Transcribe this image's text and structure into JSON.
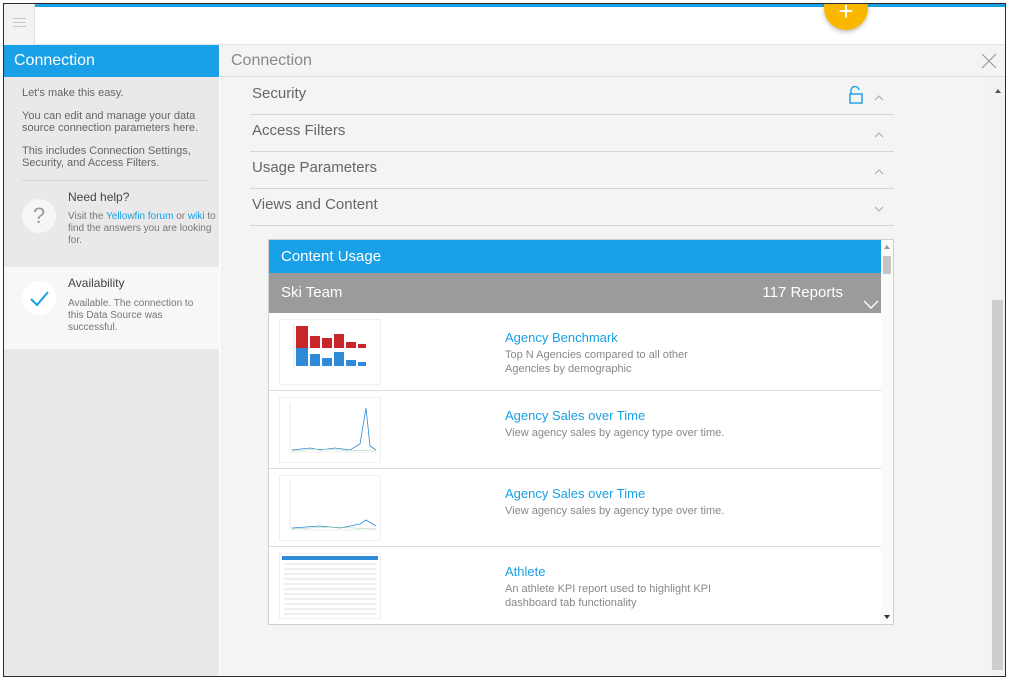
{
  "colors": {
    "accent": "#19a0e6",
    "fab": "#f9b700",
    "lock": "#19a0e6",
    "group_bar": "#9b9b9b"
  },
  "topbar": {
    "menu_icon": "hamburger-icon",
    "add_label": "+"
  },
  "sidebar": {
    "title": "Connection",
    "intro": [
      "Let's make this easy.",
      "You can edit and manage your data source connection parameters here.",
      "This includes Connection Settings, Security, and Access Filters."
    ],
    "help": {
      "title": "Need help?",
      "text_before": "Visit the ",
      "forum_link": "Yellowfin forum",
      "text_middle": " or ",
      "wiki_link": "wiki",
      "text_after": " to find the answers you are looking for."
    },
    "availability": {
      "title": "Availability",
      "text": "Available. The connection to this Data Source was successful."
    }
  },
  "main": {
    "title": "Connection",
    "sections": [
      {
        "label": "Security",
        "icon": "lock-open-icon",
        "state": "expanded"
      },
      {
        "label": "Access Filters",
        "state": "expanded"
      },
      {
        "label": "Usage Parameters",
        "state": "expanded"
      },
      {
        "label": "Views and Content",
        "state": "collapsed"
      }
    ],
    "content_usage": {
      "title": "Content Usage",
      "group": {
        "name": "Ski Team",
        "count": "117 Reports"
      },
      "reports": [
        {
          "name": "Agency Benchmark",
          "description": "Top N Agencies compared to all other Agencies by demographic",
          "thumb": "bar-chart-thumbnail"
        },
        {
          "name": "Agency Sales over Time",
          "description": "View agency sales by agency type over time.",
          "thumb": "line-chart-thumbnail"
        },
        {
          "name": "Agency Sales over Time",
          "description": "View agency sales by agency type over time.",
          "thumb": "line-chart-thumbnail"
        },
        {
          "name": "Athlete",
          "description": "An athlete KPI report used to highlight KPI dashboard tab functionality",
          "thumb": "table-thumbnail"
        }
      ]
    }
  }
}
